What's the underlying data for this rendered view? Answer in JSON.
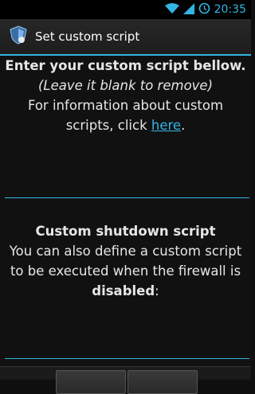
{
  "status_bar": {
    "time": "20:35",
    "icons": [
      "wifi-icon",
      "signal-icon",
      "sync-icon"
    ]
  },
  "dialog": {
    "title": "Set custom script",
    "app_icon": "shield-icon",
    "startup": {
      "heading": "Enter your custom script bellow.",
      "hint": "(Leave it blank to remove)",
      "info_prefix": "For information about custom scripts, click ",
      "link_text": "here",
      "info_suffix": ".",
      "input_value": ""
    },
    "shutdown": {
      "heading": "Custom shutdown script",
      "text": "You can also define a custom script to be executed when the firewall is ",
      "bold": "disabled",
      "suffix": ":",
      "input_value": ""
    }
  },
  "colors": {
    "accent": "#33b5e5",
    "background": "#111111",
    "title_bar": "#222222"
  }
}
